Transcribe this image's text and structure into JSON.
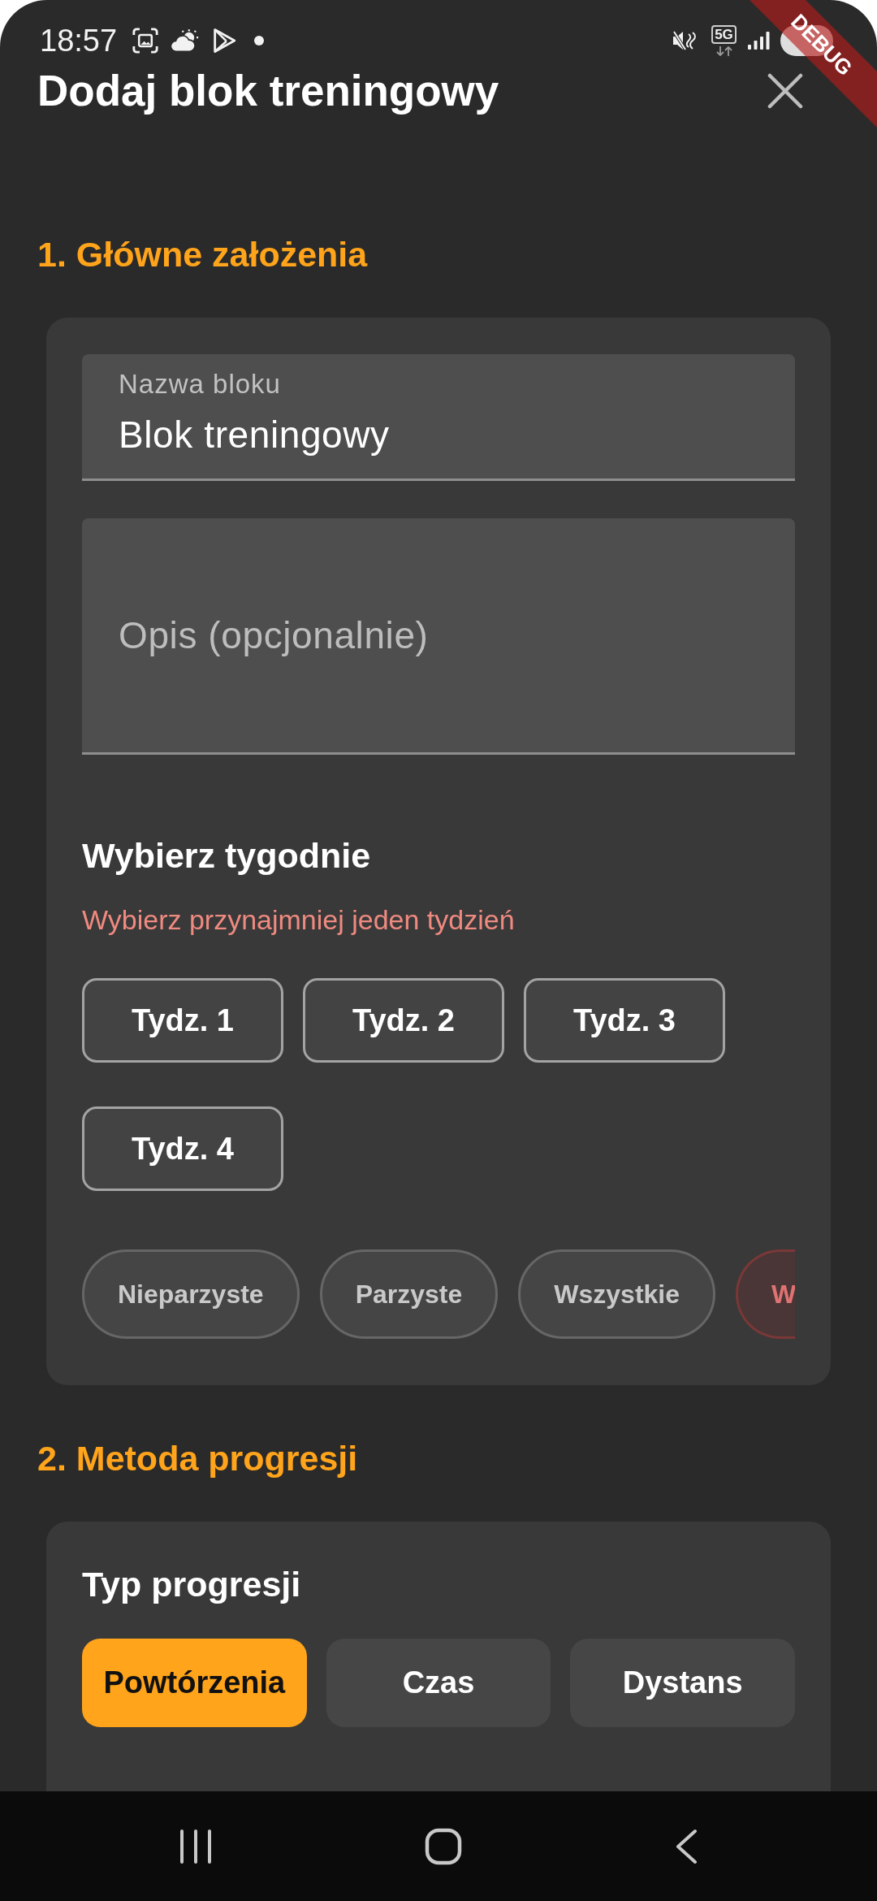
{
  "status_bar": {
    "time": "18:57",
    "network": "5G"
  },
  "debug_banner": {
    "label": "DEBUG"
  },
  "header": {
    "title": "Dodaj blok treningowy"
  },
  "section_basics": {
    "heading": "1. Główne założenia",
    "name_field": {
      "label": "Nazwa bloku",
      "value": "Blok treningowy"
    },
    "description_field": {
      "placeholder": "Opis (opcjonalnie)"
    },
    "weeks": {
      "title": "Wybierz tygodnie",
      "error": "Wybierz przynajmniej jeden tydzień",
      "items": [
        {
          "label": "Tydz. 1",
          "selected": false
        },
        {
          "label": "Tydz. 2",
          "selected": false
        },
        {
          "label": "Tydz. 3",
          "selected": false
        },
        {
          "label": "Tydz. 4",
          "selected": false
        }
      ]
    },
    "quick_picks": [
      {
        "label": "Nieparzyste",
        "kind": "neutral"
      },
      {
        "label": "Parzyste",
        "kind": "neutral"
      },
      {
        "label": "Wszystkie",
        "kind": "neutral"
      },
      {
        "label": "W",
        "kind": "danger"
      }
    ]
  },
  "section_progression": {
    "heading": "2. Metoda progresji",
    "type_title": "Typ progresji",
    "types": [
      {
        "label": "Powtórzenia",
        "selected": true
      },
      {
        "label": "Czas",
        "selected": false
      },
      {
        "label": "Dystans",
        "selected": false
      }
    ]
  }
}
